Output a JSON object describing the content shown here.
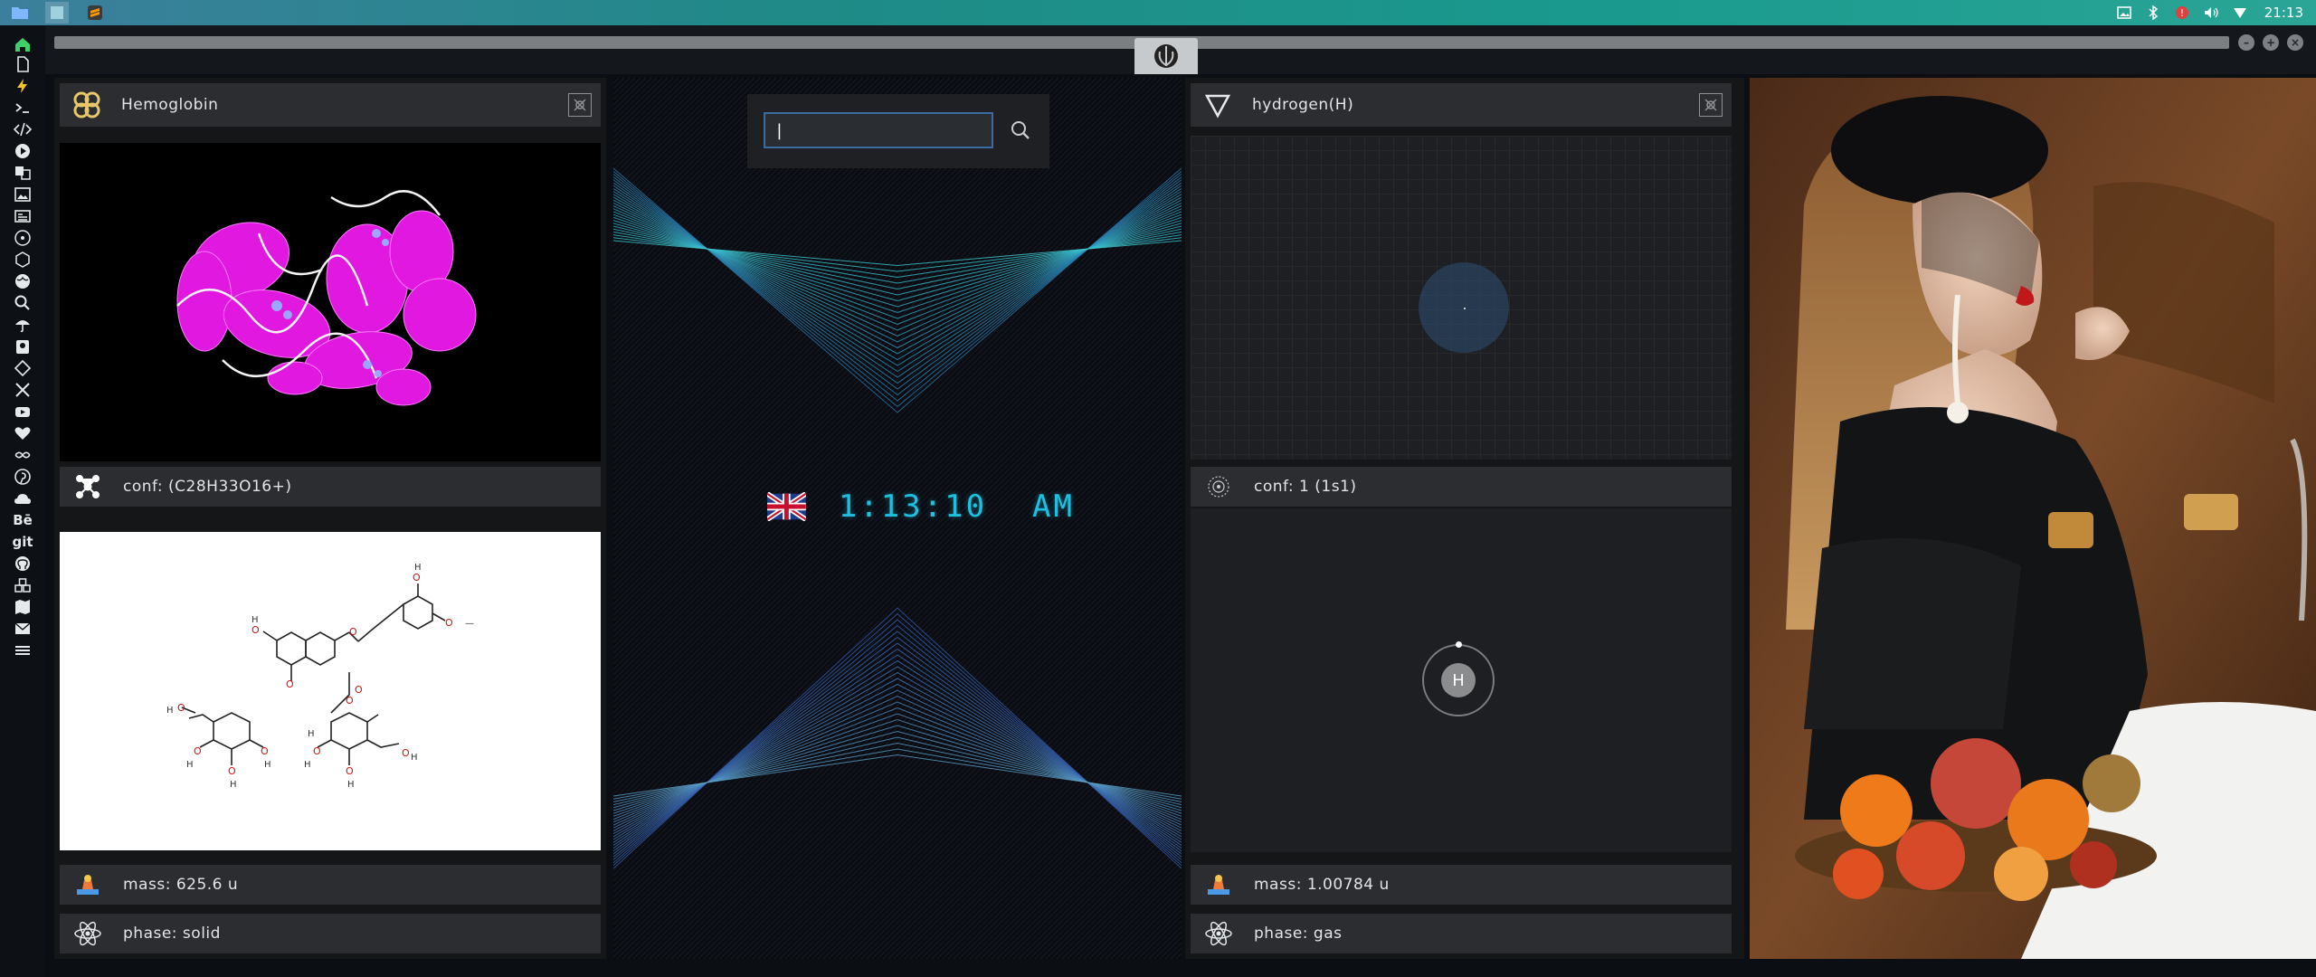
{
  "system": {
    "clock": "21:13",
    "tray_icons": [
      "image-icon",
      "bluetooth-icon",
      "shield-alert-icon",
      "volume-icon",
      "wifi-icon"
    ]
  },
  "dock": {
    "text_items": {
      "behance": "Bē",
      "git": "git"
    },
    "icons": [
      "home-icon",
      "document-icon",
      "lightning-icon",
      "terminal-icon",
      "code-icon",
      "play-icon",
      "translate-icon",
      "image-icon",
      "news-icon",
      "atom-icon",
      "hexagon-icon",
      "globe-icon",
      "search-icon",
      "umbrella-icon",
      "badge-icon",
      "diamond-icon",
      "expand-icon",
      "youtube-icon",
      "heart-icon",
      "infinity-icon",
      "pinterest-icon",
      "cloud-icon",
      "behance-icon",
      "git-icon",
      "github-icon",
      "cubes-icon",
      "map-icon",
      "mail-icon",
      "layers-icon"
    ]
  },
  "left_panel": {
    "title": "Hemoglobin",
    "conf": "conf: (C28H33O16+)",
    "mass": "mass: 625.6 u",
    "phase": "phase: solid"
  },
  "middle_panel": {
    "search": {
      "value": "|",
      "placeholder": ""
    },
    "time": "1:13:10",
    "ampm": "AM",
    "accent": "#1ec0e0"
  },
  "right_panel": {
    "title": "hydrogen(H)",
    "conf": "conf: 1 (1s1)",
    "symbol": "H",
    "mass": "mass: 1.00784 u",
    "phase": "phase: gas"
  }
}
